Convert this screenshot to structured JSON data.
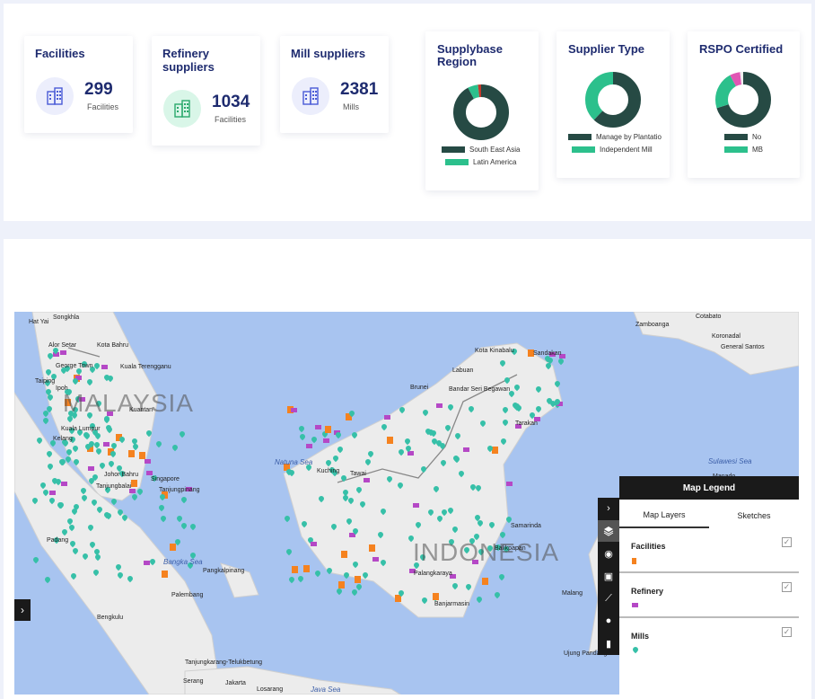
{
  "stats": {
    "facilities": {
      "title": "Facilities",
      "value": "299",
      "unit": "Facilities",
      "icon": "building-icon"
    },
    "refinery": {
      "title": "Refinery suppliers",
      "value": "1034",
      "unit": "Facilities",
      "icon": "factory-icon"
    },
    "mills": {
      "title": "Mill suppliers",
      "value": "2381",
      "unit": "Mills",
      "icon": "building-icon"
    }
  },
  "donuts": {
    "region": {
      "title": "Supplybase Region",
      "legend": [
        "South East Asia",
        "Latin America"
      ],
      "values": [
        0.92,
        0.06,
        0.02
      ],
      "colors": [
        "#264a44",
        "#2cc08c",
        "#c0392b"
      ]
    },
    "type": {
      "title": "Supplier Type",
      "legend": [
        "Manage by Plantatio",
        "Independent Mill"
      ],
      "values": [
        0.62,
        0.38
      ],
      "colors": [
        "#264a44",
        "#2cc08c"
      ]
    },
    "rspo": {
      "title": "RSPO Certified",
      "legend": [
        "No",
        "MB"
      ],
      "values": [
        0.7,
        0.22,
        0.06,
        0.02
      ],
      "colors": [
        "#264a44",
        "#2cc08c",
        "#e056b4",
        "#eeeeee"
      ]
    }
  },
  "map": {
    "countries": [
      "MALAYSIA",
      "INDONESIA"
    ],
    "seas": [
      "Natuna Sea",
      "Bangka Sea",
      "Java Sea",
      "Sulawesi Sea"
    ],
    "places": [
      "Hat Yai",
      "Songkhla",
      "Alor Setar",
      "Kota Bahru",
      "George Town",
      "Kuala Terengganu",
      "Taiping",
      "Ipoh",
      "Kuantan",
      "Kuala Lumpur",
      "Kelang",
      "Johor Bahru",
      "Singapore",
      "Tanjungbalai",
      "Tanjungpinang",
      "Padang",
      "Pangkalpinang",
      "Palembang",
      "Bengkulu",
      "Tanjungkarang-Telukbetung",
      "Jakarta",
      "Serang",
      "Losarang",
      "Kuching",
      "Tawai",
      "Brunei",
      "Bandar Seri Begawan",
      "Labuan",
      "Kota Kinabalu",
      "Sandakan",
      "Tarakan",
      "Samarinda",
      "Balikpapan",
      "Palangkaraya",
      "Banjarmasin",
      "Zamboanga",
      "Cotabato",
      "Koronadal",
      "General Santos",
      "Manado",
      "Ujung Pandang",
      "Sulawesi Sea",
      "Malang"
    ],
    "legend": {
      "title": "Map Legend",
      "tabs": [
        "Map Layers",
        "Sketches"
      ],
      "layers": [
        {
          "label": "Facilities",
          "color": "#f5821f",
          "icon": "square-icon"
        },
        {
          "label": "Refinery",
          "color": "#b548c6",
          "icon": "factory-icon"
        },
        {
          "label": "Mills",
          "color": "#36c0a8",
          "icon": "pin-icon"
        }
      ]
    },
    "check": "✓"
  }
}
